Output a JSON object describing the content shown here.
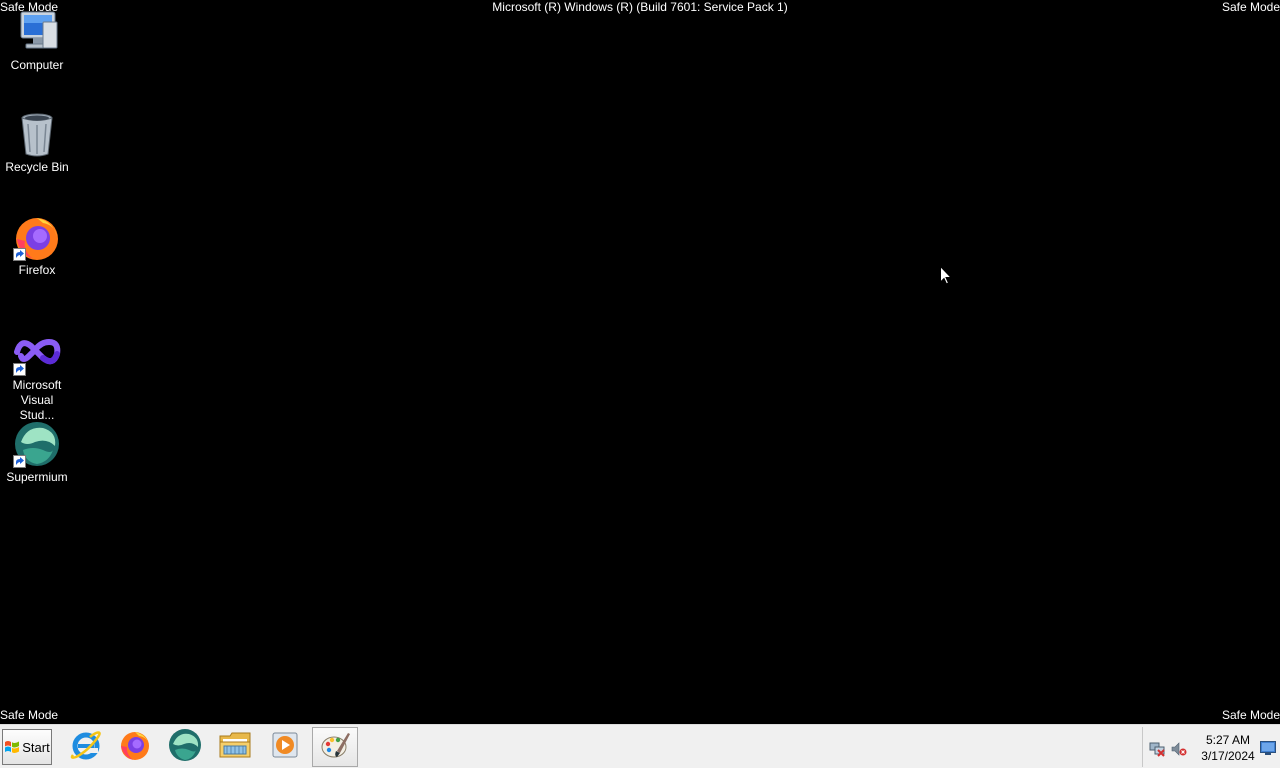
{
  "overlay": {
    "safe_mode_top_left": "Safe Mode",
    "safe_mode_top_right": "Safe Mode",
    "safe_mode_bottom_left": "Safe Mode",
    "safe_mode_bottom_right": "Safe Mode",
    "build_info": "Microsoft (R) Windows (R) (Build 7601: Service Pack 1)"
  },
  "desktop": {
    "background_color": "#000000",
    "icons": [
      {
        "label": "Computer",
        "icon": "computer-icon"
      },
      {
        "label": "Recycle Bin",
        "icon": "recycle-bin-icon"
      },
      {
        "label": "Firefox",
        "icon": "firefox-icon",
        "shortcut": true
      },
      {
        "label": "Microsoft Visual Stud...",
        "icon": "visual-studio-icon",
        "shortcut": true
      },
      {
        "label": "Supermium",
        "icon": "supermium-icon",
        "shortcut": true
      }
    ]
  },
  "taskbar": {
    "start_label": "Start",
    "pinned": [
      {
        "icon": "internet-explorer-icon"
      },
      {
        "icon": "firefox-icon"
      },
      {
        "icon": "supermium-icon"
      },
      {
        "icon": "file-explorer-icon"
      },
      {
        "icon": "media-player-icon"
      },
      {
        "icon": "paint-icon",
        "active": true
      }
    ],
    "tray": {
      "network_icon": "network-disconnected-icon",
      "volume_icon": "volume-muted-icon",
      "time": "5:27 AM",
      "date": "3/17/2024"
    }
  }
}
